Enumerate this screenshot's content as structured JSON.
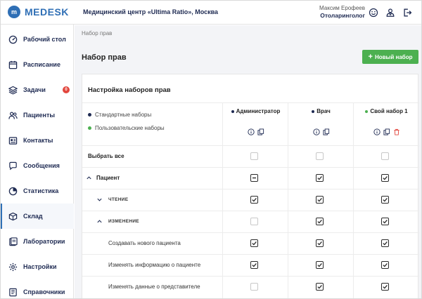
{
  "header": {
    "logo_mark": "m",
    "logo_text": "MEDESK",
    "clinic": "Медицинский центр «Ultima Ratio», Москва",
    "user_name": "Максим Ерофеев",
    "user_role": "Отоларинголог",
    "icons": [
      "smile-icon",
      "user-badge-icon",
      "logout-icon"
    ]
  },
  "sidebar": {
    "items": [
      {
        "label": "Рабочий стол",
        "icon": "dashboard-icon"
      },
      {
        "label": "Расписание",
        "icon": "calendar-icon"
      },
      {
        "label": "Задачи",
        "icon": "layers-icon",
        "badge": "0"
      },
      {
        "label": "Пациенты",
        "icon": "users-icon"
      },
      {
        "label": "Контакты",
        "icon": "contacts-icon"
      },
      {
        "label": "Сообщения",
        "icon": "chat-icon"
      },
      {
        "label": "Статистика",
        "icon": "pie-chart-icon"
      },
      {
        "label": "Склад",
        "icon": "box-icon",
        "active": true
      },
      {
        "label": "Лаборатории",
        "icon": "flask-icon"
      },
      {
        "label": "Настройки",
        "icon": "gear-icon"
      },
      {
        "label": "Справочники",
        "icon": "book-icon"
      }
    ]
  },
  "main": {
    "breadcrumb": "Набор прав",
    "title": "Набор прав",
    "new_button": "Новый набор",
    "card_title": "Настройка наборов прав",
    "legend": {
      "standard": "Стандартные наборы",
      "custom": "Пользовательские наборы"
    },
    "colors": {
      "standard": "#1e2a52",
      "custom": "#4cb050",
      "accent": "#2f6fb5",
      "delete": "#e2463d"
    },
    "columns": [
      {
        "label": "Администратор",
        "type": "standard",
        "icons": [
          "info-icon",
          "copy-icon"
        ]
      },
      {
        "label": "Врач",
        "type": "standard",
        "icons": [
          "info-icon",
          "copy-icon"
        ]
      },
      {
        "label": "Свой набор 1",
        "type": "custom",
        "icons": [
          "info-icon",
          "copy-icon",
          "trash-icon"
        ]
      }
    ],
    "rows": [
      {
        "label": "Выбрать все",
        "style": "bold",
        "level": 0,
        "chevron": null,
        "cells": [
          "off",
          "off",
          "off"
        ]
      },
      {
        "label": "Пациент",
        "style": "bold",
        "level": 0,
        "chevron": "up",
        "cells": [
          "partial",
          "on",
          "on"
        ]
      },
      {
        "label": "ЧТЕНИЕ",
        "style": "caps",
        "level": 1,
        "chevron": "down",
        "cells": [
          "on",
          "on",
          "on"
        ]
      },
      {
        "label": "ИЗМЕНЕНИЕ",
        "style": "caps",
        "level": 1,
        "chevron": "up",
        "cells": [
          "off",
          "on",
          "on"
        ]
      },
      {
        "label": "Создавать нового пациента",
        "style": "normal",
        "level": 2,
        "chevron": null,
        "cells": [
          "on",
          "on",
          "on"
        ]
      },
      {
        "label": "Изменять информацию о пациенте",
        "style": "normal",
        "level": 2,
        "chevron": null,
        "cells": [
          "on",
          "on",
          "on"
        ]
      },
      {
        "label": "Изменять данные о представителе",
        "style": "normal",
        "level": 2,
        "chevron": null,
        "cells": [
          "off",
          "on",
          "on"
        ]
      }
    ]
  }
}
